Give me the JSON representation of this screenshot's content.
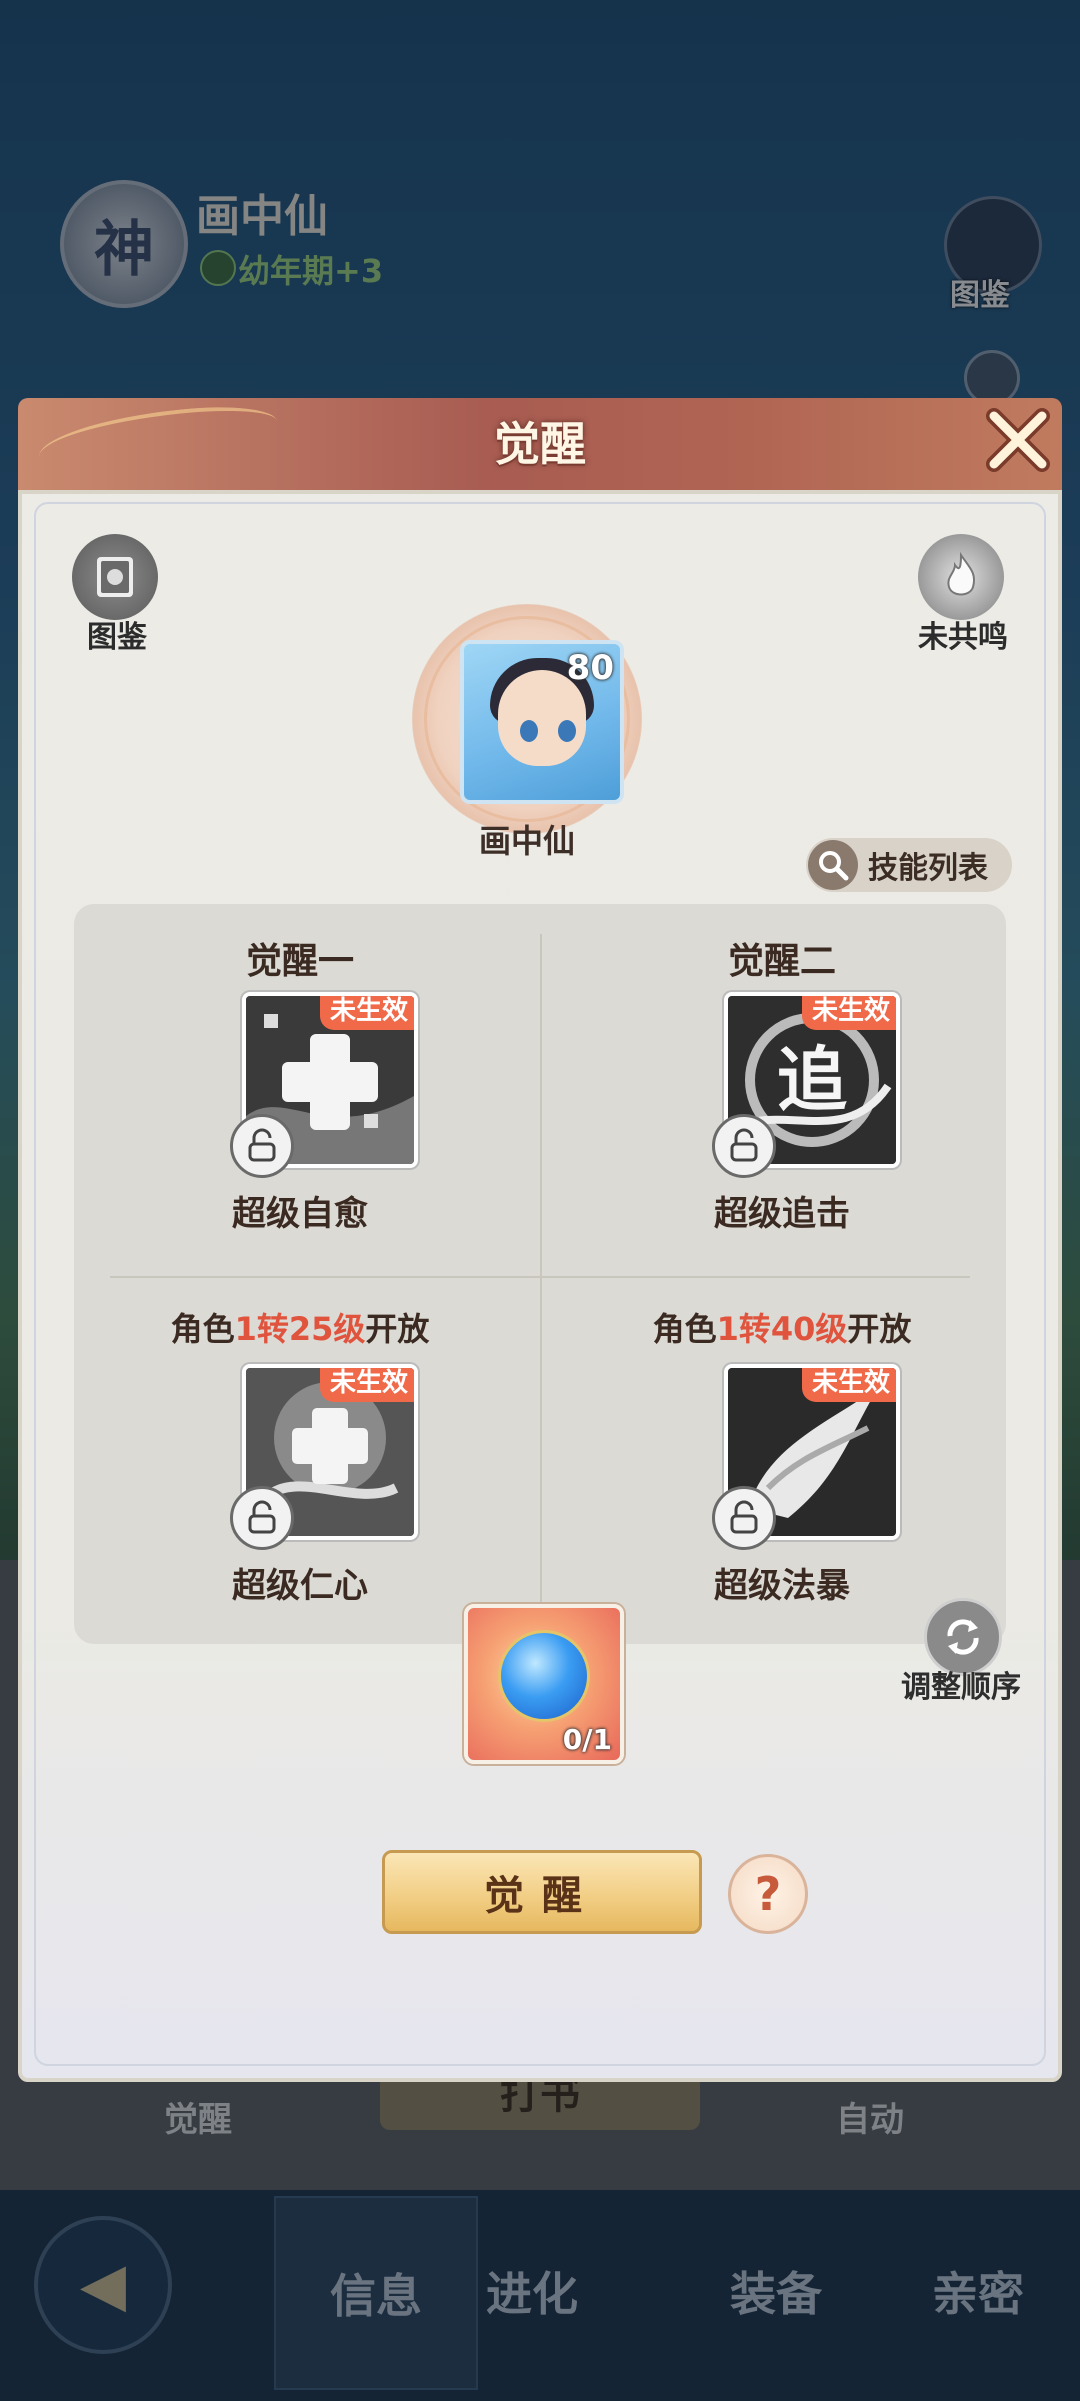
{
  "background": {
    "pet_badge": "神",
    "pet_name": "画中仙",
    "pet_stage": "幼年期+3",
    "top_right_label": "图鉴",
    "under_left_label": "觉醒",
    "under_mid_label": "打书",
    "under_right_label": "自动"
  },
  "bottom_nav": {
    "tabs": [
      {
        "label": "信息",
        "active": true
      },
      {
        "label": "进化",
        "active": false
      },
      {
        "label": "装备",
        "active": false
      },
      {
        "label": "亲密",
        "active": false
      }
    ]
  },
  "modal": {
    "title": "觉醒",
    "left_button_label": "图鉴",
    "right_button_label": "未共鸣",
    "pet": {
      "name": "画中仙",
      "level": "80"
    },
    "skill_list_label": "技能列表",
    "slots": [
      {
        "title": "觉醒一",
        "badge": "未生效",
        "skill_name": "超级自愈",
        "icon": "heal-cross-icon"
      },
      {
        "title": "觉醒二",
        "badge": "未生效",
        "skill_name": "超级追击",
        "icon": "chase-icon",
        "glyph": "追"
      },
      {
        "unlock_prefix": "角色",
        "unlock_highlight": "1转25级",
        "unlock_suffix": "开放",
        "badge": "未生效",
        "skill_name": "超级仁心",
        "icon": "benevolence-icon"
      },
      {
        "unlock_prefix": "角色",
        "unlock_highlight": "1转40级",
        "unlock_suffix": "开放",
        "badge": "未生效",
        "skill_name": "超级法暴",
        "icon": "magic-crit-icon"
      }
    ],
    "material_count": "0/1",
    "reorder_label": "调整顺序",
    "awaken_button": "觉醒",
    "help_symbol": "?"
  },
  "colors": {
    "header": "#a85c52",
    "highlight": "#e0533d",
    "badge": "#f06a4a",
    "button_gold": "#f2cf86"
  }
}
